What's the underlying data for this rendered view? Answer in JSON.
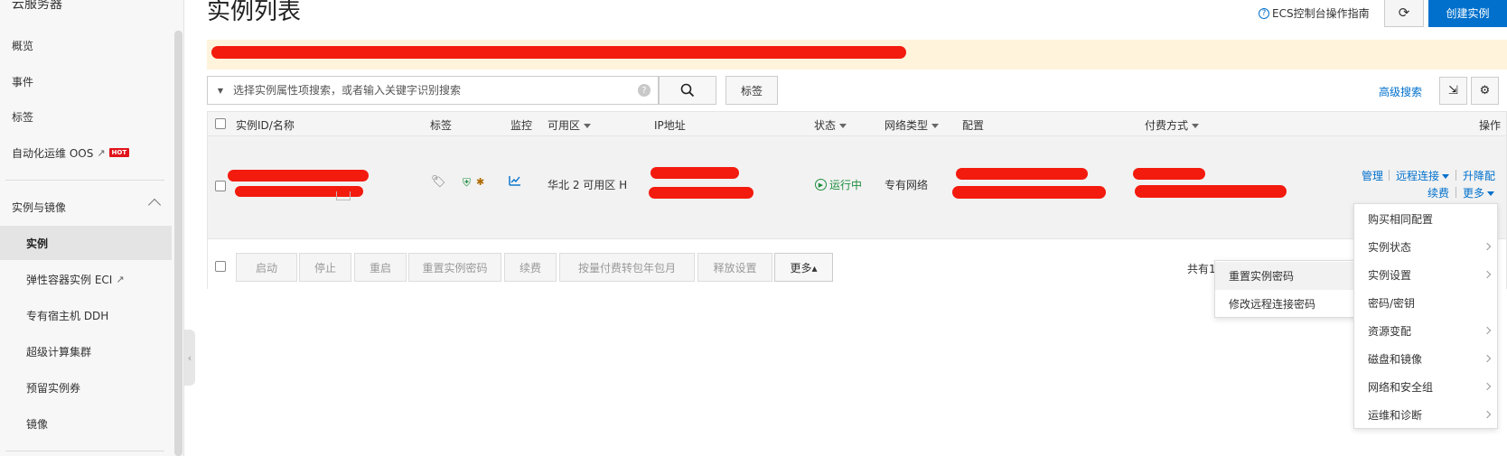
{
  "sidebar": {
    "title": "云服务器",
    "items": [
      {
        "label": "概览"
      },
      {
        "label": "事件"
      },
      {
        "label": "标签"
      },
      {
        "label": "自动化运维 OOS",
        "badge": "HOT"
      }
    ],
    "group_label": "实例与镜像",
    "sub_items": [
      {
        "label": "实例"
      },
      {
        "label": "弹性容器实例 ECI"
      },
      {
        "label": "专有宿主机 DDH"
      },
      {
        "label": "超级计算集群"
      },
      {
        "label": "预留实例券"
      },
      {
        "label": "镜像"
      }
    ]
  },
  "header": {
    "title": "实例列表",
    "guide_link": "ECS控制台操作指南",
    "create_button": "创建实例"
  },
  "search": {
    "placeholder": "选择实例属性项搜索，或者输入关键字识别搜索",
    "tag_button": "标签",
    "advanced": "高级搜索"
  },
  "table": {
    "headers": {
      "id_name": "实例ID/名称",
      "tags": "标签",
      "monitor": "监控",
      "zone": "可用区",
      "ip": "IP地址",
      "status": "状态",
      "network_type": "网络类型",
      "config": "配置",
      "billing": "付费方式",
      "actions": "操作"
    },
    "row": {
      "zone": "华北 2 可用区 H",
      "status": "运行中",
      "network_type": "专有网络",
      "actions": {
        "manage": "管理",
        "remote": "远程连接",
        "upgrade": "升降配",
        "renew": "续费",
        "more": "更多"
      }
    }
  },
  "footer": {
    "buttons": [
      "启动",
      "停止",
      "重启",
      "重置实例密码",
      "续费",
      "按量付费转包年包月",
      "释放设置"
    ],
    "more": "更多▴",
    "pagination": "共有1条"
  },
  "more_menu_left": [
    "重置实例密码",
    "修改远程连接密码"
  ],
  "more_menu_right": [
    {
      "label": "购买相同配置",
      "submenu": false
    },
    {
      "label": "实例状态",
      "submenu": true
    },
    {
      "label": "实例设置",
      "submenu": true
    },
    {
      "label": "密码/密钥",
      "submenu": false
    },
    {
      "label": "资源变配",
      "submenu": true
    },
    {
      "label": "磁盘和镜像",
      "submenu": true
    },
    {
      "label": "网络和安全组",
      "submenu": true
    },
    {
      "label": "运维和诊断",
      "submenu": true
    }
  ],
  "colors": {
    "primary": "#0070cc",
    "notice_bg": "#fff3dc",
    "running": "#1e8e3e",
    "redaction": "#f31a0e"
  }
}
